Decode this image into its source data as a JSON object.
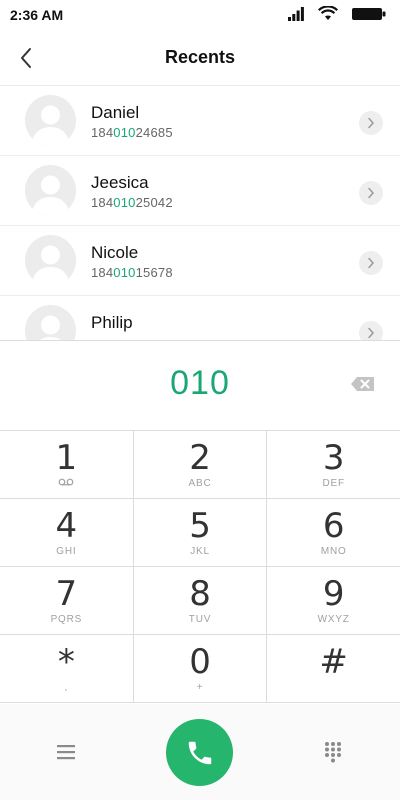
{
  "status_bar": {
    "time": "2:36 AM",
    "icons": [
      "signal-icon",
      "wifi-icon",
      "battery-icon"
    ]
  },
  "header": {
    "title": "Recents",
    "back_icon": "chevron-left-icon"
  },
  "recents": [
    {
      "name": "Daniel",
      "number_prefix": "184",
      "number_match": "010",
      "number_suffix": "24685"
    },
    {
      "name": "Jeesica",
      "number_prefix": "184",
      "number_match": "010",
      "number_suffix": "25042"
    },
    {
      "name": "Nicole",
      "number_prefix": "184",
      "number_match": "010",
      "number_suffix": "15678"
    },
    {
      "name": "Philip",
      "number_prefix": "",
      "number_match": "",
      "number_suffix": ""
    }
  ],
  "dialer": {
    "entered_number": "010",
    "backspace_icon": "backspace-icon"
  },
  "keypad": [
    [
      {
        "digit": "1",
        "letters": "",
        "sub_icon": "voicemail-icon"
      },
      {
        "digit": "2",
        "letters": "ABC"
      },
      {
        "digit": "3",
        "letters": "DEF"
      }
    ],
    [
      {
        "digit": "4",
        "letters": "GHI"
      },
      {
        "digit": "5",
        "letters": "JKL"
      },
      {
        "digit": "6",
        "letters": "MNO"
      }
    ],
    [
      {
        "digit": "7",
        "letters": "PQRS"
      },
      {
        "digit": "8",
        "letters": "TUV"
      },
      {
        "digit": "9",
        "letters": "WXYZ"
      }
    ],
    [
      {
        "digit": "*",
        "letters": ","
      },
      {
        "digit": "0",
        "letters": "+"
      },
      {
        "digit": "#",
        "letters": ""
      }
    ]
  ],
  "bottom_bar": {
    "menu_icon": "menu-icon",
    "call_icon": "phone-icon",
    "keypad_icon": "dialpad-icon"
  },
  "colors": {
    "accent": "#1aa774",
    "call_button": "#26b56c"
  }
}
